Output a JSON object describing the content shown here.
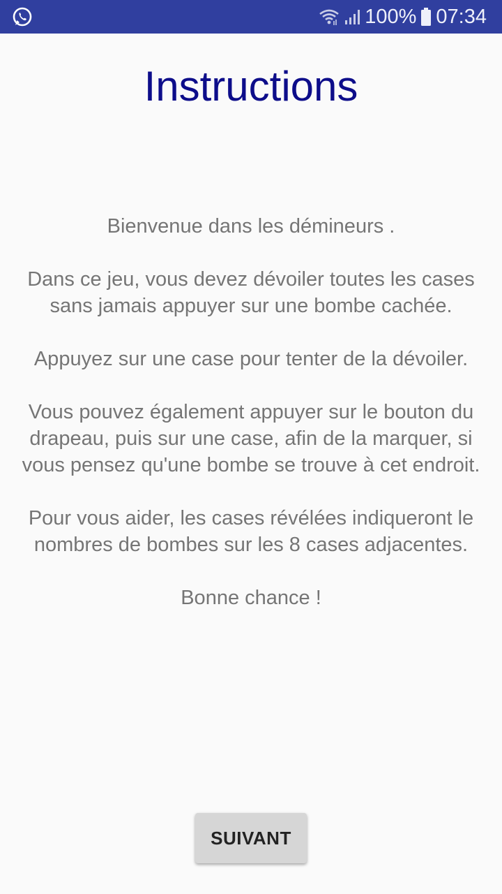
{
  "status_bar": {
    "battery": "100%",
    "time": "07:34",
    "colors": {
      "background": "#303f9f"
    },
    "icons": [
      "whatsapp-icon",
      "wifi-icon",
      "signal-icon",
      "battery-icon"
    ]
  },
  "screen": {
    "title": "Instructions",
    "paragraphs": {
      "p1": "Bienvenue dans les démineurs .",
      "p2": "Dans ce jeu, vous devez dévoiler toutes les cases sans jamais appuyer sur une bombe cachée.",
      "p3": "Appuyez sur une case pour tenter de la dévoiler.",
      "p4": "Vous pouvez également appuyer sur le bouton du drapeau, puis sur une case, afin de la marquer, si vous pensez qu'une bombe se trouve à cet endroit.",
      "p5": "Pour vous aider, les cases révélées indiqueront le nombres de bombes sur les 8 cases adjacentes.",
      "p6": "Bonne chance !"
    },
    "next_button": "SUIVANT",
    "colors": {
      "title": "#0d0d8a",
      "text": "#757575",
      "button": "#d6d6d6"
    }
  }
}
